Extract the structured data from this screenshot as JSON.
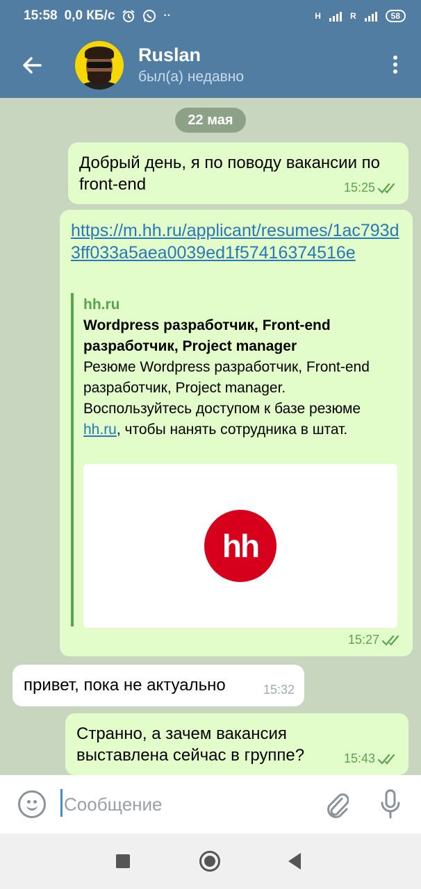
{
  "status_bar": {
    "time": "15:58",
    "net_speed": "0,0 КБ/с",
    "net_type_1": "H",
    "net_type_2": "R",
    "battery": "58",
    "icons": [
      "alarm-icon",
      "whatsapp-icon",
      "more-dots-icon",
      "signal-icon",
      "signal-icon",
      "battery-icon"
    ]
  },
  "header": {
    "name": "Ruslan",
    "status": "был(а) недавно",
    "icons": [
      "back-arrow-icon",
      "avatar",
      "more-vertical-icon"
    ]
  },
  "chat": {
    "date": "22 мая",
    "messages": [
      {
        "direction": "out",
        "text": "Добрый день, я по поводу вакансии по front-end",
        "time": "15:25",
        "read": true
      },
      {
        "direction": "out",
        "link": "https://m.hh.ru/applicant/resumes/1ac793d3ff033a5aea0039ed1f57416374516e",
        "preview": {
          "site": "hh.ru",
          "title": "Wordpress разработчик, Front-end разработчик, Project manager",
          "desc_before": "Резюме Wordpress разработчик, Front-end разработчик, Project manager. Воспользуйтесь доступом к базе резюме ",
          "desc_link": "hh.ru",
          "desc_after": ", чтобы нанять сотрудника в штат.",
          "logo_text": "hh"
        },
        "time": "15:27",
        "read": true
      },
      {
        "direction": "in",
        "text": "привет, пока не актуально",
        "time": "15:32"
      },
      {
        "direction": "out",
        "text": "Странно, а зачем вакансия выставлена сейчас в группе?",
        "time": "15:43",
        "read": true
      }
    ]
  },
  "input": {
    "placeholder": "Сообщение",
    "icons": [
      "emoji-icon",
      "attach-icon",
      "mic-icon"
    ]
  },
  "colors": {
    "header": "#517da2",
    "outgoing_bubble": "#e2fdc9",
    "incoming_bubble": "#ffffff",
    "link": "#2678b6",
    "accent_green": "#5aa451",
    "hh_red": "#d6001c"
  }
}
